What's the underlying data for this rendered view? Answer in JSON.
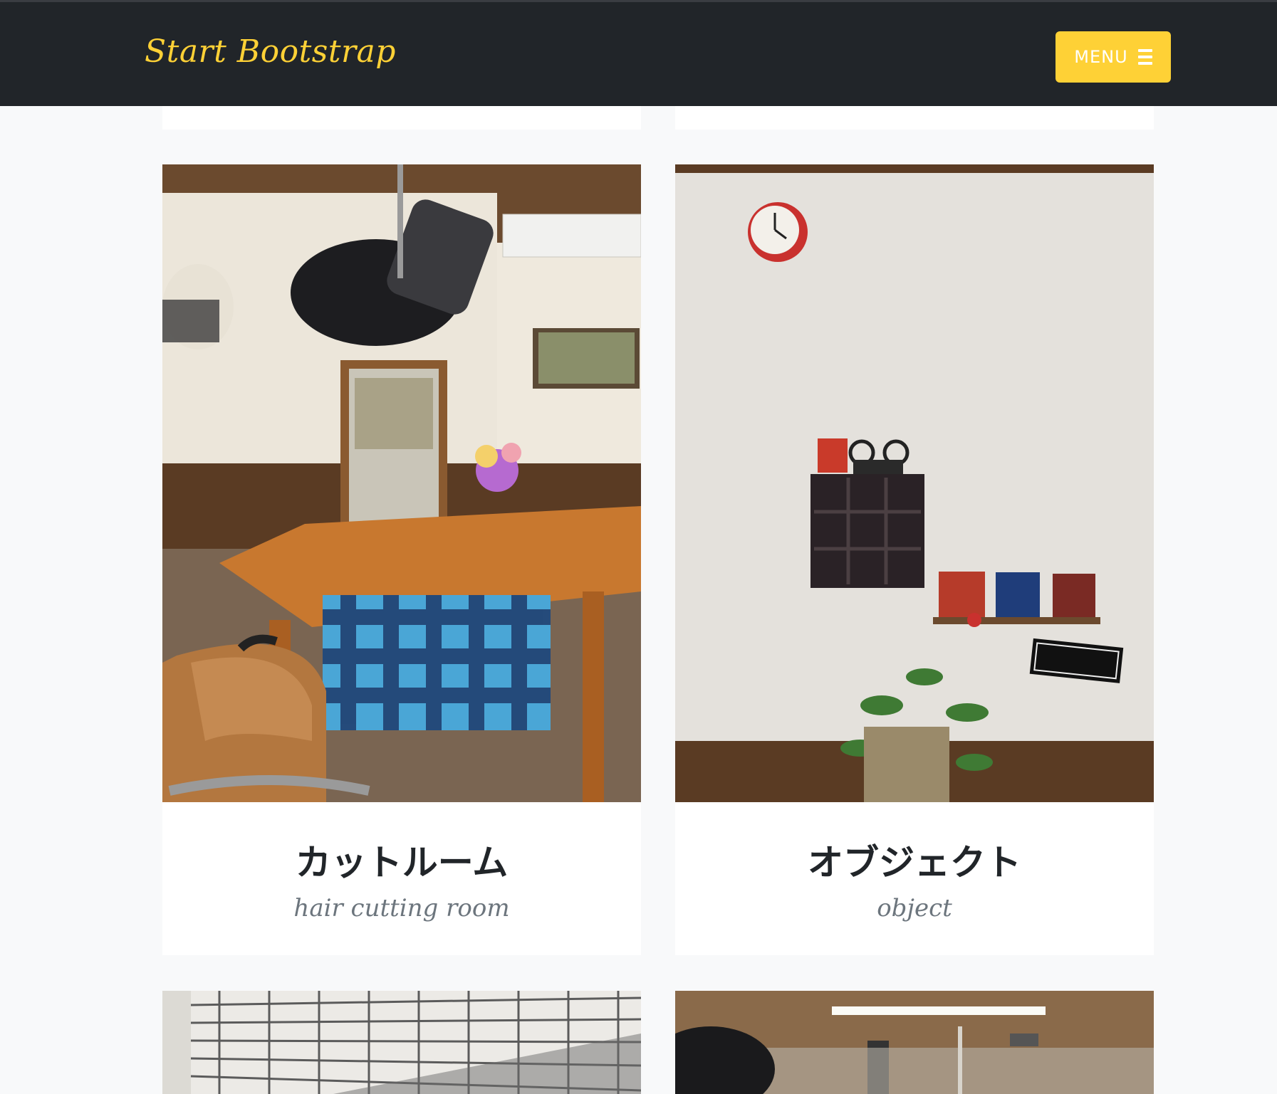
{
  "navbar": {
    "brand": "Start Bootstrap",
    "menu_label": "MENU",
    "menu_icon": "bars-icon"
  },
  "portfolio": {
    "items": [
      {
        "title": "カットルーム",
        "subtitle": "hair cutting room",
        "image": "salon-chair-mirror-photo"
      },
      {
        "title": "オブジェクト",
        "subtitle": "object",
        "image": "wall-clock-shelf-photo"
      },
      {
        "title": "",
        "subtitle": "",
        "image": "building-facade-photo"
      },
      {
        "title": "",
        "subtitle": "",
        "image": "salon-ceiling-photo"
      }
    ]
  },
  "colors": {
    "navbar_bg": "#212529",
    "accent": "#fed136",
    "page_bg": "#f8f9fa",
    "title_text": "#212529",
    "subtitle_text": "#6c757d"
  }
}
